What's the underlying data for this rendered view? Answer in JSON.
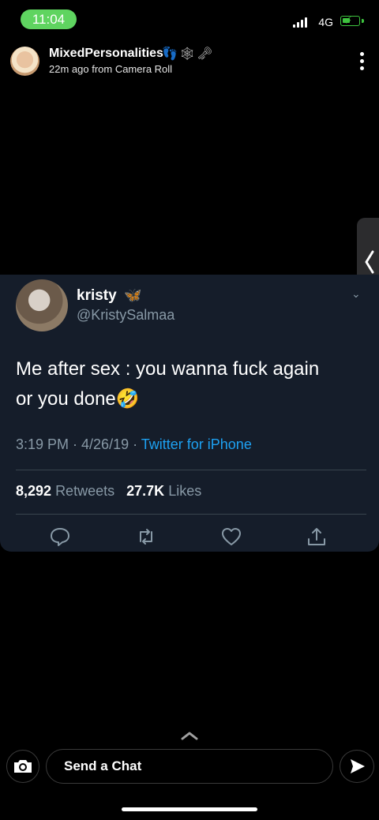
{
  "status_bar": {
    "time": "11:04",
    "network": "4G"
  },
  "story": {
    "username": "MixedPersonalities",
    "username_emojis": "👣🕸🗝",
    "subline": "22m ago from Camera Roll"
  },
  "tweet": {
    "name": "kristy",
    "name_emoji": "🦋",
    "handle": "@KristySalmaa",
    "text_line1": "Me after sex : you wanna fuck again",
    "text_line2": "or you done🤣",
    "time": "3:19 PM · 4/26/19 · ",
    "source": "Twitter for iPhone",
    "retweets_count": "8,292",
    "retweets_label": "Retweets",
    "likes_count": "27.7K",
    "likes_label": "Likes"
  },
  "chat": {
    "placeholder": "Send a Chat"
  },
  "icons": {
    "status": [
      "signal-icon",
      "battery-charging-icon"
    ],
    "header": [
      "more-options-icon"
    ],
    "tweet_actions": [
      "reply-icon",
      "retweet-icon",
      "like-icon",
      "share-icon"
    ],
    "bottom": [
      "swipe-up-icon",
      "camera-icon",
      "send-icon"
    ]
  },
  "colors": {
    "background": "#000000",
    "status_pill": "#5fd460",
    "tweet_card": "#151d2a",
    "tweet_secondary": "#8899a6",
    "tweet_link": "#1da1f2"
  }
}
